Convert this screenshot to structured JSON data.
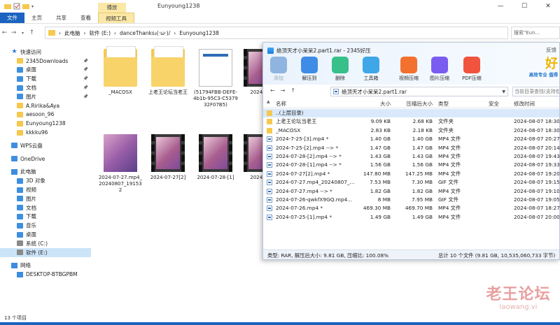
{
  "explorer": {
    "window_title": "Eunyoung1238",
    "manage_tab": "播放",
    "ribbon_tabs": [
      "文件",
      "主页",
      "共享",
      "查看",
      "视频工具"
    ],
    "address": {
      "segments": [
        "此电脑",
        "软件 (E:)",
        "danceThanks₃(·ω·)/",
        "Eunyoung1238"
      ]
    },
    "search_placeholder": "搜索\"Eun...",
    "nav": [
      {
        "label": "快速访问",
        "level": 0,
        "icon": "star"
      },
      {
        "label": "2345Downloads",
        "level": 1,
        "icon": "folder",
        "pinned": true
      },
      {
        "label": "桌面",
        "level": 1,
        "icon": "blue",
        "pinned": true
      },
      {
        "label": "下载",
        "level": 1,
        "icon": "blue",
        "pinned": true
      },
      {
        "label": "文档",
        "level": 1,
        "icon": "blue",
        "pinned": true
      },
      {
        "label": "图片",
        "level": 1,
        "icon": "blue",
        "pinned": true
      },
      {
        "label": "A.Ririka&Aya",
        "level": 1,
        "icon": "folder"
      },
      {
        "label": "aesoon_96",
        "level": 1,
        "icon": "folder"
      },
      {
        "label": "Eunyoung1238",
        "level": 1,
        "icon": "folder"
      },
      {
        "label": "kkkku96",
        "level": 1,
        "icon": "folder"
      },
      {
        "gap": true
      },
      {
        "label": "WPS云盘",
        "level": 0,
        "icon": "blue"
      },
      {
        "gap": true
      },
      {
        "label": "OneDrive",
        "level": 0,
        "icon": "blue"
      },
      {
        "gap": true
      },
      {
        "label": "此电脑",
        "level": 0,
        "icon": "pc"
      },
      {
        "label": "3D 对象",
        "level": 1,
        "icon": "blue"
      },
      {
        "label": "视频",
        "level": 1,
        "icon": "blue"
      },
      {
        "label": "图片",
        "level": 1,
        "icon": "blue"
      },
      {
        "label": "文档",
        "level": 1,
        "icon": "blue"
      },
      {
        "label": "下载",
        "level": 1,
        "icon": "blue"
      },
      {
        "label": "音乐",
        "level": 1,
        "icon": "blue"
      },
      {
        "label": "桌面",
        "level": 1,
        "icon": "blue"
      },
      {
        "label": "系统 (C:)",
        "level": 1,
        "icon": "drive"
      },
      {
        "label": "软件 (E:)",
        "level": 1,
        "icon": "drive",
        "selected": true
      },
      {
        "gap": true
      },
      {
        "label": "网络",
        "level": 0,
        "icon": "pc"
      },
      {
        "label": "DESKTOP-BTBGPBM",
        "level": 1,
        "icon": "pc"
      }
    ],
    "tiles": [
      {
        "label": "_MACOSX",
        "kind": "folder"
      },
      {
        "label": "上老王论坛当老王",
        "kind": "folder"
      },
      {
        "label": "(51794FBB-DEFE-4b1b-95C3-C537932F07B5)",
        "kind": "doc"
      },
      {
        "label": "2024-07",
        "kind": "film"
      },
      {
        "label": "2024-07-27.mp4_20240807_191532",
        "kind": "photo"
      },
      {
        "label": "2024-07-27[2]",
        "kind": "film"
      },
      {
        "label": "2024-07-28-[1]",
        "kind": "film"
      },
      {
        "label": "2024-07",
        "kind": "film"
      }
    ],
    "status": "13 个项目"
  },
  "zip": {
    "title": "绝顶天才小呆呆2.part1.rar - 2345好压",
    "feedback": "反馈",
    "tools": [
      {
        "label": "添加",
        "icon": "add-icon",
        "color": "#8fb4e0",
        "dim": true
      },
      {
        "label": "解压到",
        "icon": "extract-icon",
        "color": "#3f8ce6"
      },
      {
        "label": "删除",
        "icon": "delete-icon",
        "color": "#38c08a"
      },
      {
        "label": "工具箱",
        "icon": "toolbox-icon",
        "color": "#3fa7e8"
      },
      {
        "label": "视频压缩",
        "icon": "video-compress-icon",
        "color": "#f2712e"
      },
      {
        "label": "图片压缩",
        "icon": "image-compress-icon",
        "color": "#7b5cf0"
      },
      {
        "label": "PDF压缩",
        "icon": "pdf-compress-icon",
        "color": "#f0533e"
      }
    ],
    "promo_big": "好",
    "promo_small": "高效专业 值得",
    "path": "绝顶天才小呆呆2.part1.rar",
    "search_placeholder": "当前目录查找(支持包",
    "columns": [
      "名称",
      "大小",
      "压缩后大小",
      "类型",
      "安全",
      "修改时间"
    ],
    "rows": [
      {
        "name": "..(上层目录)",
        "size": "",
        "packed": "",
        "type": "",
        "time": "",
        "icon": "folder",
        "selected": true
      },
      {
        "name": "上老王论坛当老王",
        "size": "9.09 KB",
        "packed": "2.68 KB",
        "type": "文件夹",
        "time": "2024-08-07 18:30",
        "icon": "folder"
      },
      {
        "name": "_MACOSX",
        "size": "2.83 KB",
        "packed": "2.18 KB",
        "type": "文件夹",
        "time": "2024-08-07 18:30",
        "icon": "folder"
      },
      {
        "name": "2024-7-25-[3].mp4 *",
        "size": "1.40 GB",
        "packed": "1.40 GB",
        "type": "MP4 文件",
        "time": "2024-08-07 20:27",
        "icon": "file"
      },
      {
        "name": "2024-7-25-[2].mp4 --> *",
        "size": "1.47 GB",
        "packed": "1.47 GB",
        "type": "MP4 文件",
        "time": "2024-08-07 20:14",
        "icon": "file"
      },
      {
        "name": "2024-07-28-[2].mp4 --> *",
        "size": "1.43 GB",
        "packed": "1.43 GB",
        "type": "MP4 文件",
        "time": "2024-08-07 19:43",
        "icon": "file"
      },
      {
        "name": "2024-07-28-[1].mp4 --> *",
        "size": "1.56 GB",
        "packed": "1.56 GB",
        "type": "MP4 文件",
        "time": "2024-08-07 19:33",
        "icon": "file"
      },
      {
        "name": "2024-07-27[2].mp4 *",
        "size": "147.80 MB",
        "packed": "147.25 MB",
        "type": "MP4 文件",
        "time": "2024-08-07 19:20",
        "icon": "file"
      },
      {
        "name": "2024-07-27.mp4_20240807_...",
        "size": "7.53 MB",
        "packed": "7.30 MB",
        "type": "GIF 文件",
        "time": "2024-08-07 19:15",
        "icon": "file"
      },
      {
        "name": "2024-07-27.mp4 --> *",
        "size": "1.82 GB",
        "packed": "1.82 GB",
        "type": "MP4 文件",
        "time": "2024-08-07 19:10",
        "icon": "file"
      },
      {
        "name": "2024-07-26-qwkfX9GQ.mp4...",
        "size": "8 MB",
        "packed": "7.95 MB",
        "type": "GIF 文件",
        "time": "2024-08-07 19:05",
        "icon": "file"
      },
      {
        "name": "2024-07-26.mp4 *",
        "size": "469.30 MB",
        "packed": "469.70 MB",
        "type": "MP4 文件",
        "time": "2024-08-07 18:27",
        "icon": "file"
      },
      {
        "name": "2024-07-25-[1].mp4 *",
        "size": "1.49 GB",
        "packed": "1.49 GB",
        "type": "MP4 文件",
        "time": "2024-08-07 20:00",
        "icon": "file"
      }
    ],
    "status_left": "类型: RAR, 解压后大小: 9.81 GB, 压缩比: 100.08%",
    "status_right": "总计 10 个文件 (9.81 GB, 10,535,060,733 字节)"
  },
  "watermark": {
    "line1": "老王论坛",
    "line2": "laowang.vi"
  }
}
